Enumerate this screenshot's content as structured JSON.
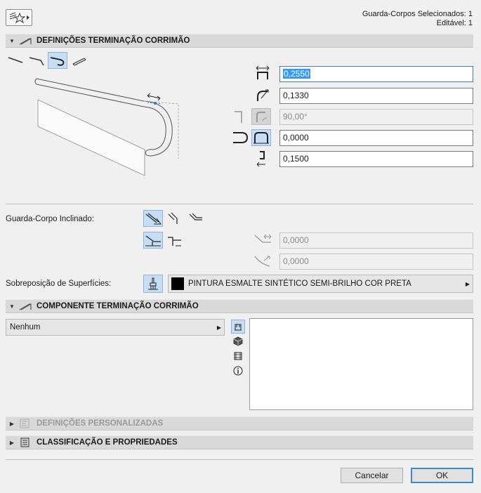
{
  "header": {
    "selected_line": "Guarda-Corpos Selecionados: 1",
    "editable_line": "Editável: 1"
  },
  "sections": {
    "termination": "DEFINIÇÕES TERMINAÇÃO CORRIMÃO",
    "component": "COMPONENTE TERMINAÇÃO CORRIMÃO",
    "custom": "DEFINIÇÕES PERSONALIZADAS",
    "classification": "CLASSIFICAÇÃO E PROPRIEDADES"
  },
  "fields": {
    "length": "0,2550",
    "radius": "0,1330",
    "angle": "90,00°",
    "offset": "0,0000",
    "drop": "0,1500",
    "slope_a": "0,0000",
    "slope_b": "0,0000"
  },
  "labels": {
    "inclined": "Guarda-Corpo Inclinado:",
    "surface": "Sobreposição de Superfícies:"
  },
  "surface": {
    "value": "PINTURA ESMALTE SINTÉTICO SEMI-BRILHO COR PRETA",
    "swatch": "#000000"
  },
  "component": {
    "value": "Nenhum"
  },
  "buttons": {
    "cancel": "Cancelar",
    "ok": "OK"
  },
  "colors": {
    "accent": "#3399ff",
    "selected_bg": "#c6ddf4"
  }
}
